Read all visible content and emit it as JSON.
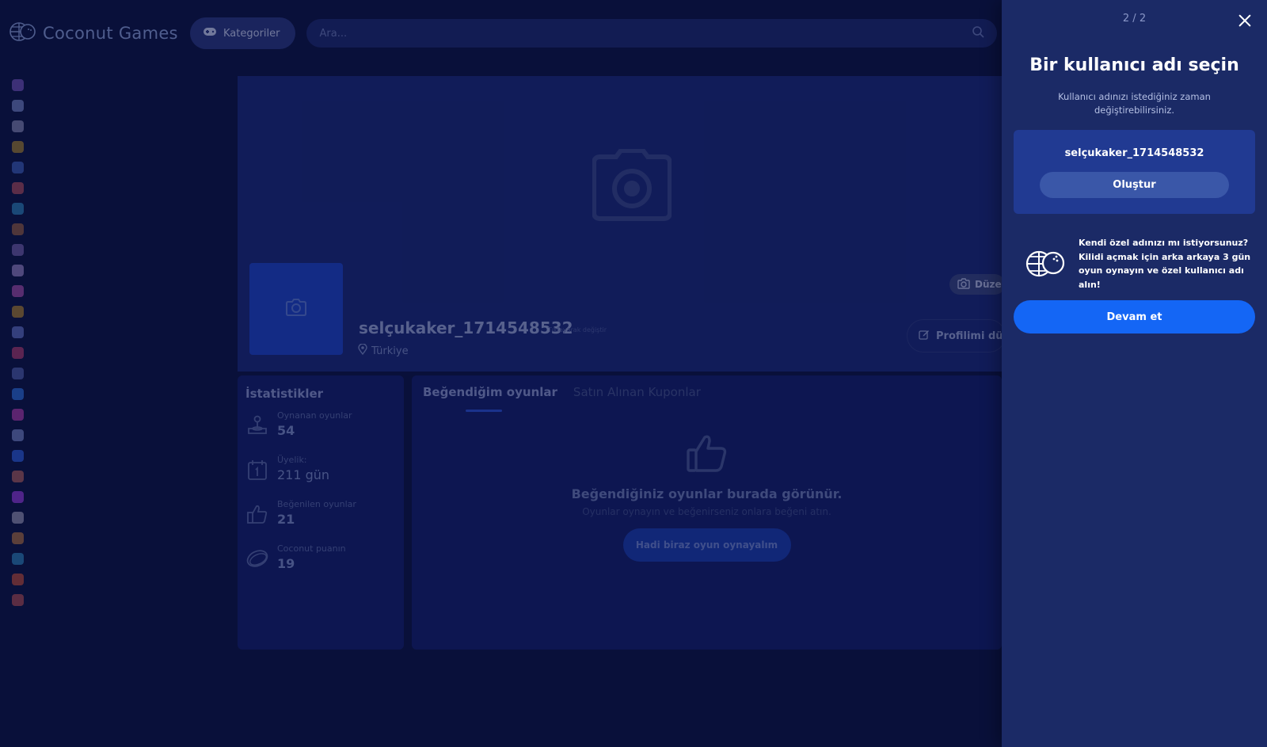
{
  "header": {
    "brand": "Coconut Games",
    "categories_label": "Kategoriler",
    "search_placeholder": "Ara..."
  },
  "sidebar": {
    "icons": [
      {
        "name": "planet-icon",
        "color": "#6a4fb0"
      },
      {
        "name": "ghost-icon",
        "color": "#6a7ab8"
      },
      {
        "name": "soccer-ball-icon",
        "color": "#7a7fa8"
      },
      {
        "name": "trophy-icon",
        "color": "#9a7a30"
      },
      {
        "name": "joystick-icon",
        "color": "#3a5ab0"
      },
      {
        "name": "cards-icon",
        "color": "#a04a5a"
      },
      {
        "name": "clock-icon",
        "color": "#2a7ab0"
      },
      {
        "name": "pickaxe-icon",
        "color": "#8a5a40"
      },
      {
        "name": "magic-wand-icon",
        "color": "#6a5aa0"
      },
      {
        "name": "stars-icon",
        "color": "#8a7ab8"
      },
      {
        "name": "potion-icon",
        "color": "#9a4aa0"
      },
      {
        "name": "pacman-icon",
        "color": "#a07a30"
      },
      {
        "name": "rocket-icon",
        "color": "#5a6ab8"
      },
      {
        "name": "target-icon",
        "color": "#a03a6a"
      },
      {
        "name": "eye-icon",
        "color": "#4a5aa0"
      },
      {
        "name": "check-badge-icon",
        "color": "#2a6ad0"
      },
      {
        "name": "compass-icon",
        "color": "#a03aa0"
      },
      {
        "name": "puzzle-icon",
        "color": "#6a7ab8"
      },
      {
        "name": "shuffle-icon",
        "color": "#2a5ad0"
      },
      {
        "name": "sparkle-icon",
        "color": "#a05a5a"
      },
      {
        "name": "gamepad-icon",
        "color": "#8a3ad0"
      },
      {
        "name": "gun-icon",
        "color": "#8a8aa8"
      },
      {
        "name": "explosion-icon",
        "color": "#a06a40"
      },
      {
        "name": "racing-icon",
        "color": "#2a7ab0"
      },
      {
        "name": "basketball-icon",
        "color": "#b04a3a"
      },
      {
        "name": "door-icon",
        "color": "#a04a50"
      }
    ]
  },
  "profile": {
    "username": "selçukaker_1714548532",
    "username_hint": "Tıklayarak değiştir",
    "location": "Türkiye",
    "cover_edit_label": "Düzen",
    "edit_profile_label": "Profilimi düzen"
  },
  "stats": {
    "title": "İstatistikler",
    "items": [
      {
        "label": "Oynanan oyunlar",
        "value": "54"
      },
      {
        "label": "Üyelik:",
        "value": "211 gün"
      },
      {
        "label": "Beğenilen oyunlar",
        "value": "21"
      },
      {
        "label": "Coconut puanın",
        "value": "19"
      }
    ]
  },
  "likes": {
    "tabs": [
      {
        "label": "Beğendiğim oyunlar",
        "active": true
      },
      {
        "label": "Satın Alınan Kuponlar",
        "active": false
      }
    ],
    "empty_title": "Beğendiğiniz oyunlar burada görünür.",
    "empty_sub": "Oyunlar oynayın ve beğenirseniz onlara beğeni atın.",
    "cta_label": "Hadi biraz oyun oynayalım"
  },
  "drawer": {
    "step": "2 / 2",
    "title": "Bir kullanıcı adı seçin",
    "subtitle": "Kullanıcı adınızı istediğiniz zaman değiştirebilirsiniz.",
    "suggested_name": "selçukaker_1714548532",
    "create_label": "Oluştur",
    "promo_text": "Kendi özel adınızı mı istiyorsunuz? Kilidi açmak için arka arkaya 3 gün oyun oynayın ve özel kullanıcı adı alın!",
    "continue_label": "Devam et"
  },
  "colors": {
    "background": "#0c1440",
    "drawer": "#1b2a66",
    "accent": "#1466f5"
  }
}
